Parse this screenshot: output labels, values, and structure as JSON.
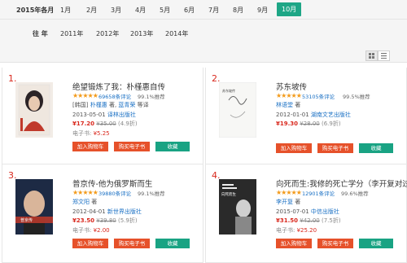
{
  "filters": {
    "month_label": "2015年各月",
    "months": [
      "1月",
      "2月",
      "3月",
      "4月",
      "5月",
      "6月",
      "7月",
      "8月",
      "9月",
      "10月"
    ],
    "active_month": "10月",
    "year_label": "往 年",
    "years": [
      "2011年",
      "2012年",
      "2013年",
      "2014年"
    ]
  },
  "books": [
    {
      "rank": "1.",
      "title": "绝望锻炼了我：朴槿惠自传",
      "stars": "★★★★★",
      "reviews": "69658条评论",
      "recommend": "99.1%推荐",
      "author_prefix": "[韩国]",
      "author": "朴槿惠",
      "author_sep": "著",
      "translator": "蓝青荣",
      "translator_suffix": "等译",
      "date": "2013-05-01",
      "publisher": "译林出版社",
      "price": "¥17.20",
      "old_price": "¥35.00",
      "discount": "(4.9折)",
      "ebook_label": "电子书:",
      "ebook_price": "¥5.25",
      "btn_cart": "加入购物车",
      "btn_ebook": "购买电子书",
      "btn_fav": "收藏"
    },
    {
      "rank": "2.",
      "title": "苏东坡传",
      "stars": "★★★★★",
      "reviews": "53105条评论",
      "recommend": "99.5%推荐",
      "author": "林语堂",
      "author_sep": "著",
      "date": "2012-01-01",
      "publisher": "湖南文艺出版社",
      "price": "¥19.30",
      "old_price": "¥28.00",
      "discount": "(6.9折)",
      "btn_cart": "加入购物车",
      "btn_ebook": "购买电子书",
      "btn_fav": "收藏"
    },
    {
      "rank": "3.",
      "title": "普京传-他为俄罗斯而生",
      "stars": "★★★★★",
      "reviews": "39880条评论",
      "recommend": "99.1%推荐",
      "author": "郑文阳",
      "author_sep": "著",
      "date": "2012-04-01",
      "publisher": "新世界出版社",
      "price": "¥23.50",
      "old_price": "¥39.80",
      "discount": "(5.9折)",
      "ebook_label": "电子书:",
      "ebook_price": "¥2.00",
      "btn_cart": "加入购物车",
      "btn_ebook": "购买电子书",
      "btn_fav": "收藏"
    },
    {
      "rank": "4.",
      "title": "向死而生:我修的死亡学分（李开复对过",
      "stars": "★★★★★",
      "reviews": "12901条评论",
      "recommend": "99.6%推荐",
      "author": "李开复",
      "author_sep": "著",
      "date": "2015-07-01",
      "publisher": "中信出版社",
      "price": "¥31.50",
      "old_price": "¥42.00",
      "discount": "(7.5折)",
      "ebook_label": "电子书:",
      "ebook_price": "¥25.20",
      "btn_cart": "加入购物车",
      "btn_ebook": "购买电子书",
      "btn_fav": "收藏"
    }
  ],
  "cover_texts": {
    "c2": "苏东坡传",
    "c3": "普京传",
    "c4": "向死而生"
  },
  "colors": {
    "accent": "#1ea686",
    "price": "#d9281d",
    "star": "#f39a19",
    "cart": "#e6512a"
  }
}
